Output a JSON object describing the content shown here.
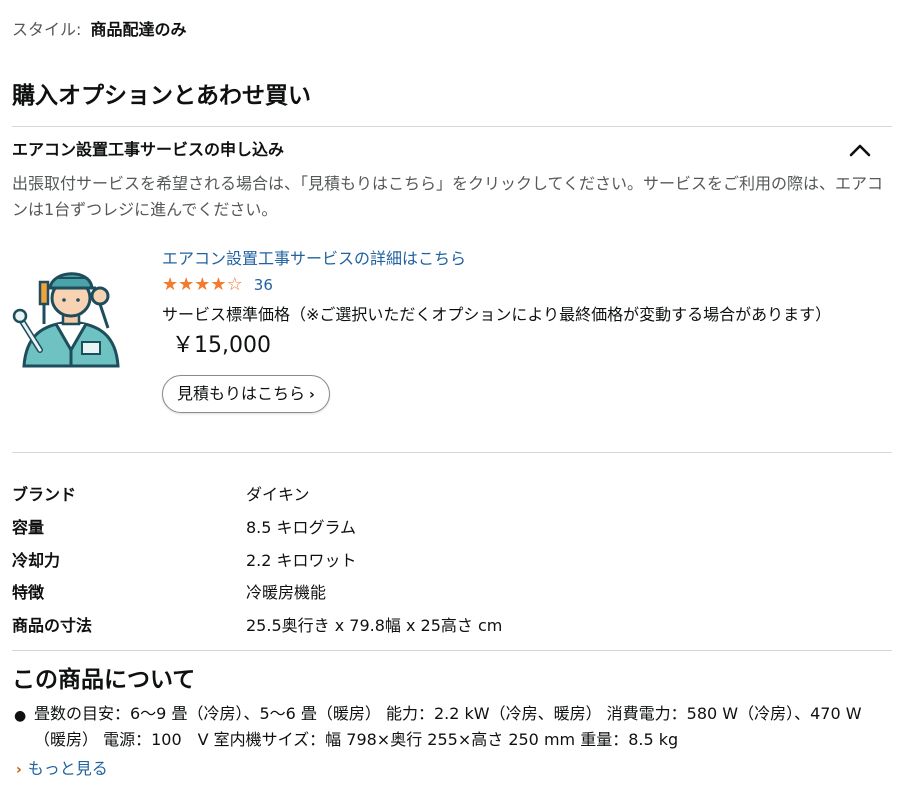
{
  "style_row": {
    "label": "スタイル:",
    "value": "商品配達のみ"
  },
  "options_section": {
    "title": "購入オプションとあわせ買い"
  },
  "accordion": {
    "title": "エアコン設置工事サービスの申し込み",
    "expanded": true,
    "description": "出張取付サービスを希望される場合は、「見積もりはこちら」をクリックしてください。サービスをご利用の際は、エアコンは1台ずつレジに進んでください。"
  },
  "service": {
    "link": "エアコン設置工事サービスの詳細はこちら",
    "rating_stars": 4,
    "rating_count": "36",
    "price_note": "サービス標準価格（※ご選択いただくオプションにより最終価格が変動する場合があります）",
    "price_value": "￥15,000",
    "quote_button": "見積もりはこちら"
  },
  "specs": [
    {
      "key": "ブランド",
      "value": "ダイキン"
    },
    {
      "key": "容量",
      "value": "8.5 キログラム"
    },
    {
      "key": "冷却力",
      "value": "2.2 キロワット"
    },
    {
      "key": "特徴",
      "value": "冷暖房機能"
    },
    {
      "key": "商品の寸法",
      "value": "25.5奥行き x 79.8幅 x 25高さ cm"
    }
  ],
  "about": {
    "title": "この商品について",
    "bullet": "畳数の目安：6～9 畳（冷房）、5～6 畳（暖房） 能力：2.2 kW（冷房、暖房） 消費電力：580 W（冷房）、470 W（暖房） 電源：100　V 室内機サイズ：幅 798×奥行 255×高さ 250 mm 重量：8.5 kg",
    "more_link": "もっと見る"
  },
  "colors": {
    "link": "#2162a1",
    "star": "#f27b2f",
    "divider": "#d5d9d9",
    "illustration_teal": "#4aa3a8"
  }
}
